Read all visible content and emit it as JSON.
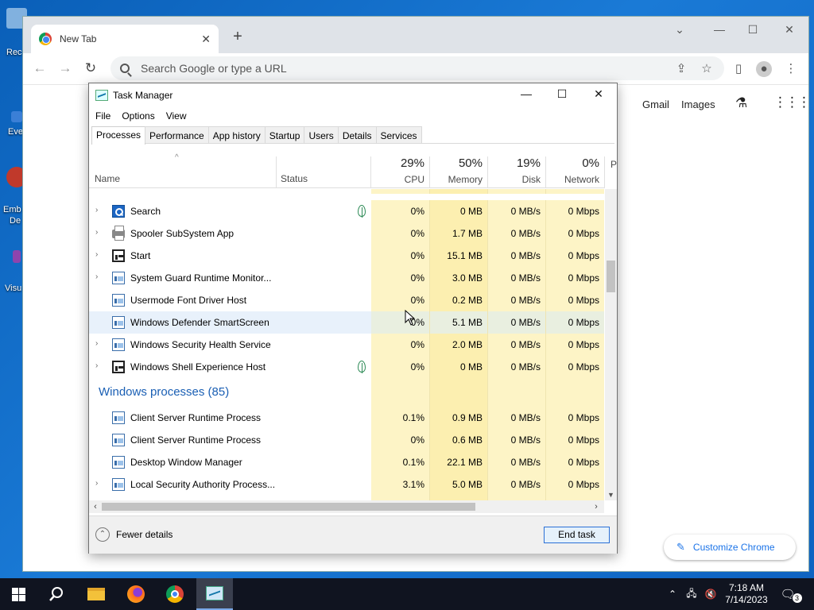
{
  "desktop": {
    "icons": [
      {
        "label": "Rec",
        "color": "#9fc5e8"
      },
      {
        "label": "Eve",
        "color": "#d9534f"
      },
      {
        "label": "Emb",
        "color": "#c0392b"
      },
      {
        "label": "De",
        "color": ""
      },
      {
        "label": "Visu",
        "color": "#8e44ad"
      }
    ]
  },
  "chrome": {
    "tab_title": "New Tab",
    "omnibox_placeholder": "Search Google or type a URL",
    "links": {
      "gmail": "Gmail",
      "images": "Images"
    },
    "customize_label": "Customize Chrome"
  },
  "task_manager": {
    "title": "Task Manager",
    "menu": [
      "File",
      "Options",
      "View"
    ],
    "tabs": [
      "Processes",
      "Performance",
      "App history",
      "Startup",
      "Users",
      "Details",
      "Services"
    ],
    "active_tab": "Processes",
    "columns": {
      "name": "Name",
      "status": "Status",
      "cpu": {
        "label": "CPU",
        "pct": "29%"
      },
      "memory": {
        "label": "Memory",
        "pct": "50%"
      },
      "disk": {
        "label": "Disk",
        "pct": "19%"
      },
      "network": {
        "label": "Network",
        "pct": "0%"
      },
      "extra": "P"
    },
    "rows": [
      {
        "name": "Search",
        "expand": true,
        "icon": "search",
        "leaf": true,
        "cpu": "0%",
        "mem": "0 MB",
        "disk": "0 MB/s",
        "net": "0 Mbps"
      },
      {
        "name": "Spooler SubSystem App",
        "expand": true,
        "icon": "printer",
        "leaf": false,
        "cpu": "0%",
        "mem": "1.7 MB",
        "disk": "0 MB/s",
        "net": "0 Mbps"
      },
      {
        "name": "Start",
        "expand": true,
        "icon": "dark",
        "leaf": false,
        "cpu": "0%",
        "mem": "15.1 MB",
        "disk": "0 MB/s",
        "net": "0 Mbps"
      },
      {
        "name": "System Guard Runtime Monitor...",
        "expand": true,
        "icon": "app",
        "leaf": false,
        "cpu": "0%",
        "mem": "3.0 MB",
        "disk": "0 MB/s",
        "net": "0 Mbps"
      },
      {
        "name": "Usermode Font Driver Host",
        "expand": false,
        "icon": "app",
        "leaf": false,
        "cpu": "0%",
        "mem": "0.2 MB",
        "disk": "0 MB/s",
        "net": "0 Mbps"
      },
      {
        "name": "Windows Defender SmartScreen",
        "expand": false,
        "icon": "app",
        "leaf": false,
        "cpu": "0%",
        "mem": "5.1 MB",
        "disk": "0 MB/s",
        "net": "0 Mbps",
        "highlight": true
      },
      {
        "name": "Windows Security Health Service",
        "expand": true,
        "icon": "app",
        "leaf": false,
        "cpu": "0%",
        "mem": "2.0 MB",
        "disk": "0 MB/s",
        "net": "0 Mbps"
      },
      {
        "name": "Windows Shell Experience Host",
        "expand": true,
        "icon": "dark",
        "leaf": true,
        "cpu": "0%",
        "mem": "0 MB",
        "disk": "0 MB/s",
        "net": "0 Mbps"
      }
    ],
    "group_title": "Windows processes (85)",
    "group_rows": [
      {
        "name": "Client Server Runtime Process",
        "expand": false,
        "icon": "app",
        "cpu": "0.1%",
        "mem": "0.9 MB",
        "disk": "0 MB/s",
        "net": "0 Mbps"
      },
      {
        "name": "Client Server Runtime Process",
        "expand": false,
        "icon": "app",
        "cpu": "0%",
        "mem": "0.6 MB",
        "disk": "0 MB/s",
        "net": "0 Mbps"
      },
      {
        "name": "Desktop Window Manager",
        "expand": false,
        "icon": "app",
        "cpu": "0.1%",
        "mem": "22.1 MB",
        "disk": "0 MB/s",
        "net": "0 Mbps"
      },
      {
        "name": "Local Security Authority Process...",
        "expand": true,
        "icon": "app",
        "cpu": "3.1%",
        "mem": "5.0 MB",
        "disk": "0 MB/s",
        "net": "0 Mbps"
      }
    ],
    "fewer_details": "Fewer details",
    "end_task": "End task"
  },
  "taskbar": {
    "time": "7:18 AM",
    "date": "7/14/2023",
    "notification_count": "3"
  }
}
